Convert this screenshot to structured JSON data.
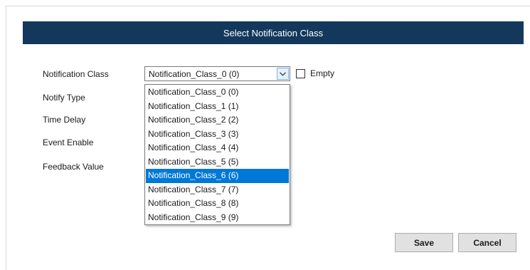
{
  "dialog": {
    "title": "Select Notification Class"
  },
  "form": {
    "labels": [
      "Notification Class",
      "Notify Type",
      "Time Delay",
      "Event Enable",
      "Feedback Value"
    ],
    "notification_class_value": "Notification_Class_0 (0)",
    "empty_label": "Empty",
    "empty_checked": false
  },
  "dropdown": {
    "options": [
      "Notification_Class_0 (0)",
      "Notification_Class_1 (1)",
      "Notification_Class_2 (2)",
      "Notification_Class_3 (3)",
      "Notification_Class_4 (4)",
      "Notification_Class_5 (5)",
      "Notification_Class_6 (6)",
      "Notification_Class_7 (7)",
      "Notification_Class_8 (8)",
      "Notification_Class_9 (9)"
    ],
    "highlighted": "Notification_Class_6 (6)"
  },
  "buttons": {
    "save": "Save",
    "cancel": "Cancel"
  },
  "colors": {
    "header_bg": "#13385c",
    "selection": "#0078d7"
  },
  "icons": {
    "combo_arrow": "chevron-down-icon"
  }
}
